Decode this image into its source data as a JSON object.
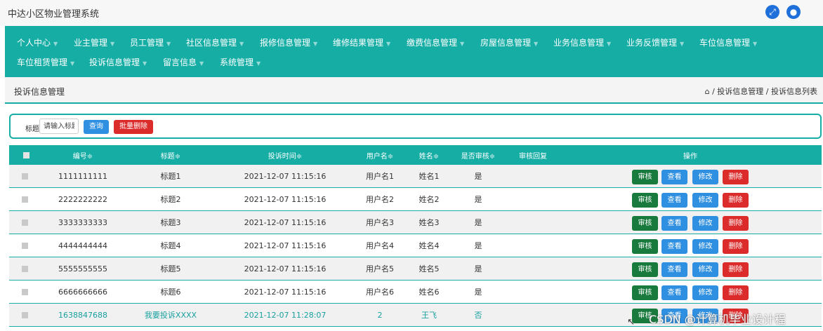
{
  "app": {
    "title": "中达小区物业管理系统",
    "icons": [
      "expand-icon",
      "user-icon"
    ]
  },
  "nav": {
    "items": [
      {
        "label": "个人中心"
      },
      {
        "label": "业主管理"
      },
      {
        "label": "员工管理"
      },
      {
        "label": "社区信息管理"
      },
      {
        "label": "报修信息管理"
      },
      {
        "label": "维修结果管理"
      },
      {
        "label": "缴费信息管理"
      },
      {
        "label": "房屋信息管理"
      },
      {
        "label": "业务信息管理"
      },
      {
        "label": "业务反馈管理"
      },
      {
        "label": "车位信息管理"
      },
      {
        "label": "车位租赁管理"
      },
      {
        "label": "投诉信息管理"
      },
      {
        "label": "留言信息"
      },
      {
        "label": "系统管理"
      }
    ]
  },
  "page": {
    "title": "投诉信息管理",
    "breadcrumb": "/ 投诉信息管理 / 投诉信息列表"
  },
  "search": {
    "label": "标题",
    "placeholder": "请输入标题",
    "query_label": "查询",
    "batch_delete_label": "批量删除"
  },
  "table": {
    "headers": {
      "id": "编号≑",
      "title": "标题≑",
      "time": "投诉时间≑",
      "username": "用户名≑",
      "name": "姓名≑",
      "audited": "是否审核≑",
      "reply": "审核回复",
      "ops": "操作"
    },
    "rows": [
      {
        "id": "1111111111",
        "title": "标题1",
        "time": "2021-12-07 11:15:16",
        "username": "用户名1",
        "name": "姓名1",
        "audited": "是"
      },
      {
        "id": "2222222222",
        "title": "标题2",
        "time": "2021-12-07 11:15:16",
        "username": "用户名2",
        "name": "姓名2",
        "audited": "是"
      },
      {
        "id": "3333333333",
        "title": "标题3",
        "time": "2021-12-07 11:15:16",
        "username": "用户名3",
        "name": "姓名3",
        "audited": "是"
      },
      {
        "id": "4444444444",
        "title": "标题4",
        "time": "2021-12-07 11:15:16",
        "username": "用户名4",
        "name": "姓名4",
        "audited": "是"
      },
      {
        "id": "5555555555",
        "title": "标题5",
        "time": "2021-12-07 11:15:16",
        "username": "用户名5",
        "name": "姓名5",
        "audited": "是"
      },
      {
        "id": "6666666666",
        "title": "标题6",
        "time": "2021-12-07 11:15:16",
        "username": "用户名6",
        "name": "姓名6",
        "audited": "是"
      },
      {
        "id": "1638847688",
        "title": "我要投诉XXXX",
        "time": "2021-12-07 11:28:07",
        "username": "2",
        "name": "王飞",
        "audited": "否"
      }
    ],
    "actions": {
      "audit": "审核",
      "view": "查看",
      "edit": "修改",
      "delete": "删除"
    }
  },
  "watermark": "CSDN @计算机毕业设计程",
  "colors": {
    "teal": "#16ada5",
    "blue": "#2f8fe0",
    "red": "#dc2b2b",
    "green": "#187a3d"
  }
}
